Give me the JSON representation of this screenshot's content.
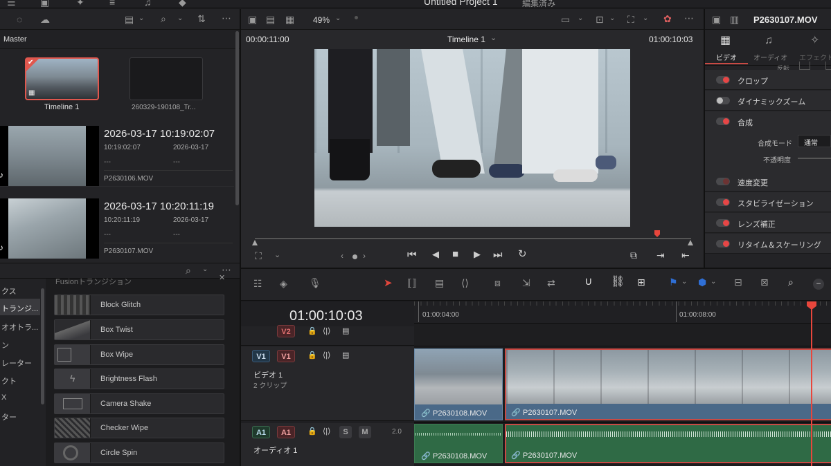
{
  "topbar": {
    "project_title": "Untitled Project 1",
    "status": "編集済み"
  },
  "media_pool": {
    "bin_label": "Master",
    "tiles": [
      {
        "name": "Timeline 1"
      },
      {
        "name": "260329-190108_Tr..."
      }
    ],
    "clips": [
      {
        "title": "2026-03-17  10:19:02:07",
        "time": "10:19:02:07",
        "date": "2026-03-17",
        "dash1": "---",
        "dash2": "---",
        "file": "P2630106.MOV"
      },
      {
        "title": "2026-03-17  10:20:11:19",
        "time": "10:20:11:19",
        "date": "2026-03-17",
        "dash1": "---",
        "dash2": "---",
        "file": "P2630107.MOV"
      }
    ]
  },
  "effects": {
    "group_title": "Fusionトランジション",
    "sidebar": [
      "クス",
      "トランジ...",
      "オオトラ...",
      "ン",
      "レーター",
      "クト",
      "X",
      "ター"
    ],
    "items": [
      "Block Glitch",
      "Box Twist",
      "Box Wipe",
      "Brightness Flash",
      "Camera Shake",
      "Checker Wipe",
      "Circle Spin"
    ]
  },
  "viewer": {
    "zoom": "49%",
    "source_tc": "00:00:11:00",
    "timeline_name": "Timeline 1",
    "record_tc": "01:00:10:03"
  },
  "inspector": {
    "clip_name": "P2630107.MOV",
    "tabs": [
      "ビデオ",
      "オーディオ",
      "エフェクト"
    ],
    "flip_label": "反転",
    "rows": [
      "クロップ",
      "ダイナミックズーム",
      "合成",
      "速度変更",
      "スタビライゼーション",
      "レンズ補正",
      "リタイム＆スケーリング"
    ],
    "composite_mode_label": "合成モード",
    "composite_mode_value": "通常",
    "opacity_label": "不透明度"
  },
  "timeline": {
    "timecode": "01:00:10:03",
    "ruler": [
      "01:00:04:00",
      "01:00:08:00"
    ],
    "v2": "V2",
    "v1_a": "V1",
    "v1_b": "V1",
    "video_track_name": "ビデオ 1",
    "video_track_clips": "2 クリップ",
    "a1_a": "A1",
    "a1_b": "A1",
    "solo": "S",
    "mute": "M",
    "level": "2.0",
    "audio_track_name": "オーディオ 1",
    "clips": [
      "P2630108.MOV",
      "P2630107.MOV"
    ]
  },
  "colors": {
    "accent_red": "#e64646",
    "video_clip": "#4a6988",
    "audio_clip": "#2f6a45",
    "playhead": "#e8463c"
  }
}
